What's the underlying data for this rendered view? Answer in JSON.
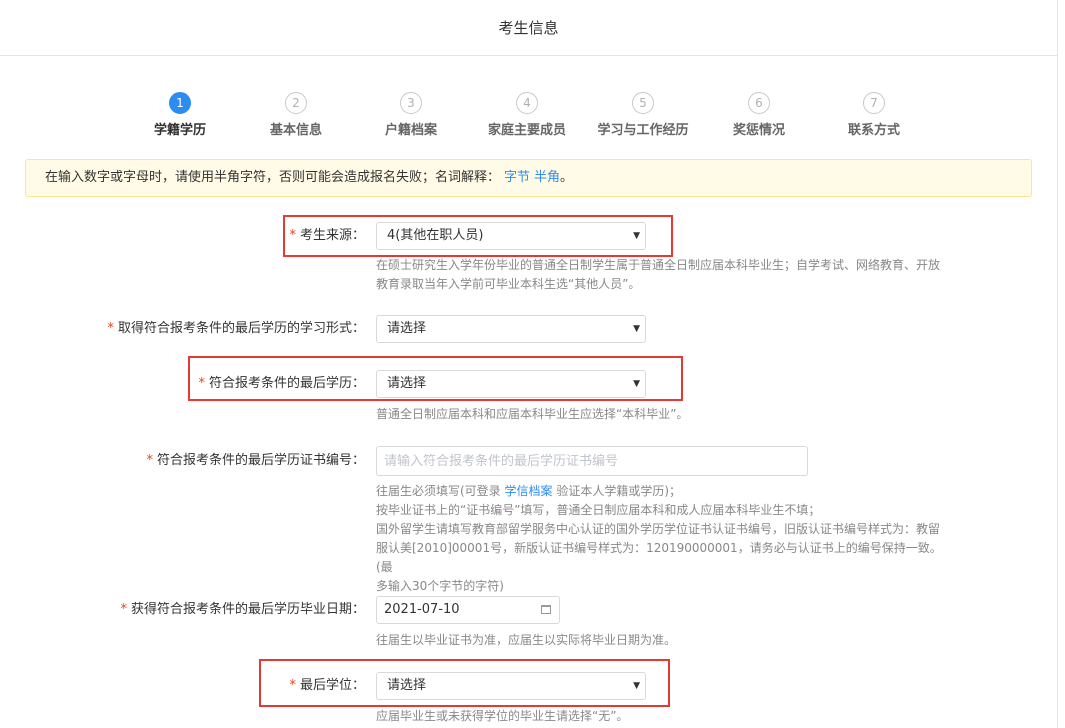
{
  "header": {
    "title": "考生信息"
  },
  "steps": [
    {
      "num": "1",
      "label": "学籍学历"
    },
    {
      "num": "2",
      "label": "基本信息"
    },
    {
      "num": "3",
      "label": "户籍档案"
    },
    {
      "num": "4",
      "label": "家庭主要成员"
    },
    {
      "num": "5",
      "label": "学习与工作经历"
    },
    {
      "num": "6",
      "label": "奖惩情况"
    },
    {
      "num": "7",
      "label": "联系方式"
    }
  ],
  "notice": {
    "text": "在输入数字或字母时，请使用半角字符，否则可能会造成报名失败；名词解释：",
    "link1": "字节",
    "link2": "半角",
    "tail": "。"
  },
  "form": {
    "source": {
      "label": "考生来源：",
      "value": "4(其他在职人员)",
      "help1": "在硕士研究生入学年份毕业的普通全日制学生属于普通全日制应届本科毕业生；自学考试、网络教育、开放",
      "help2": "教育录取当年入学前可毕业本科生选“其他人员”。"
    },
    "study_form": {
      "label": "取得符合报考条件的最后学历的学习形式：",
      "value": "请选择"
    },
    "last_edu": {
      "label": "符合报考条件的最后学历：",
      "value": "请选择",
      "help": "普通全日制应届本科和应届本科毕业生应选择“本科毕业”。"
    },
    "cert_no": {
      "label": "符合报考条件的最后学历证书编号：",
      "placeholder": "请输入符合报考条件的最后学历证书编号",
      "help1_a": "往届生必须填写(可登录 ",
      "help1_link": "学信档案",
      "help1_b": " 验证本人学籍或学历)；",
      "help2": "按毕业证书上的“证书编号”填写，普通全日制应届本科和成人应届本科毕业生不填；",
      "help3": "国外留学生请填写教育部留学服务中心认证的国外学历学位证书认证书编号，旧版认证书编号样式为：教留",
      "help4": "服认美[2010]00001号，新版认证书编号样式为：120190000001，请务必与认证书上的编号保持一致。(最",
      "help5": "多输入30个字节的字符)"
    },
    "grad_date": {
      "label": "获得符合报考条件的最后学历毕业日期：",
      "value": "2021-07-10",
      "help": "往届生以毕业证书为准，应届生以实际将毕业日期为准。"
    },
    "degree": {
      "label": "最后学位：",
      "value": "请选择",
      "help": "应届毕业生或未获得学位的毕业生请选择“无”。"
    },
    "required_mark": "*"
  },
  "colors": {
    "accent": "#2d8cf0",
    "required": "#ed4014",
    "highlight": "#e53935",
    "notice_bg": "#fffbe6"
  }
}
